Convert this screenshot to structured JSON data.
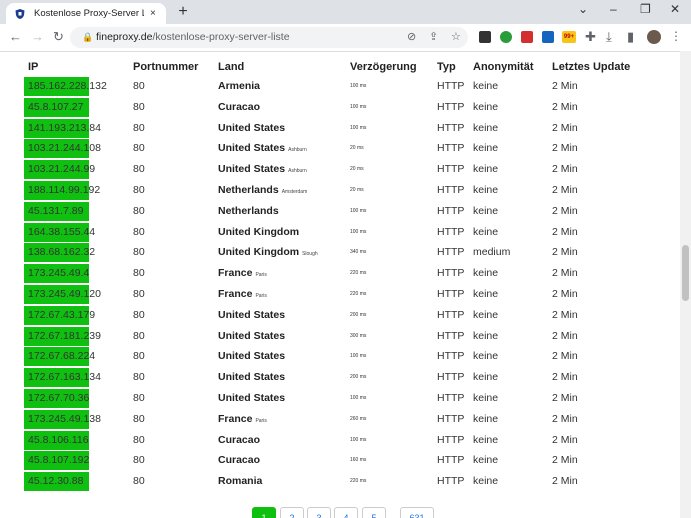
{
  "browser": {
    "tab_title": "Kostenlose Proxy-Server Liste: M",
    "url_domain": "fineproxy.de",
    "url_path": "/kostenlose-proxy-server-liste",
    "new_tab": "+",
    "close_tab": "×",
    "min": "⌄",
    "restore": "–",
    "maximize": "❐",
    "close": "✕",
    "badge_99": "99+"
  },
  "table": {
    "headers": {
      "ip": "IP",
      "port": "Portnummer",
      "country": "Land",
      "delay": "Verzögerung",
      "type": "Typ",
      "anon": "Anonymität",
      "update": "Letztes Update"
    },
    "rows": [
      {
        "ip": "185.162.228.132",
        "port": "80",
        "country": "Armenia",
        "city": "",
        "delay": "100 ms",
        "type": "HTTP",
        "anon": "keine",
        "update": "2 Min"
      },
      {
        "ip": "45.8.107.27",
        "port": "80",
        "country": "Curacao",
        "city": "",
        "delay": "100 ms",
        "type": "HTTP",
        "anon": "keine",
        "update": "2 Min"
      },
      {
        "ip": "141.193.213.84",
        "port": "80",
        "country": "United States",
        "city": "",
        "delay": "100 ms",
        "type": "HTTP",
        "anon": "keine",
        "update": "2 Min"
      },
      {
        "ip": "103.21.244.108",
        "port": "80",
        "country": "United States",
        "city": "Ashburn",
        "delay": "20 ms",
        "type": "HTTP",
        "anon": "keine",
        "update": "2 Min"
      },
      {
        "ip": "103.21.244.99",
        "port": "80",
        "country": "United States",
        "city": "Ashburn",
        "delay": "20 ms",
        "type": "HTTP",
        "anon": "keine",
        "update": "2 Min"
      },
      {
        "ip": "188.114.99.192",
        "port": "80",
        "country": "Netherlands",
        "city": "Amsterdam",
        "delay": "20 ms",
        "type": "HTTP",
        "anon": "keine",
        "update": "2 Min"
      },
      {
        "ip": "45.131.7.89",
        "port": "80",
        "country": "Netherlands",
        "city": "",
        "delay": "100 ms",
        "type": "HTTP",
        "anon": "keine",
        "update": "2 Min"
      },
      {
        "ip": "164.38.155.44",
        "port": "80",
        "country": "United Kingdom",
        "city": "",
        "delay": "100 ms",
        "type": "HTTP",
        "anon": "keine",
        "update": "2 Min"
      },
      {
        "ip": "138.68.162.32",
        "port": "80",
        "country": "United Kingdom",
        "city": "Slough",
        "delay": "340 ms",
        "type": "HTTP",
        "anon": "medium",
        "update": "2 Min"
      },
      {
        "ip": "173.245.49.4",
        "port": "80",
        "country": "France",
        "city": "Paris",
        "delay": "220 ms",
        "type": "HTTP",
        "anon": "keine",
        "update": "2 Min"
      },
      {
        "ip": "173.245.49.120",
        "port": "80",
        "country": "France",
        "city": "Paris",
        "delay": "220 ms",
        "type": "HTTP",
        "anon": "keine",
        "update": "2 Min"
      },
      {
        "ip": "172.67.43.179",
        "port": "80",
        "country": "United States",
        "city": "",
        "delay": "200 ms",
        "type": "HTTP",
        "anon": "keine",
        "update": "2 Min"
      },
      {
        "ip": "172.67.181.239",
        "port": "80",
        "country": "United States",
        "city": "",
        "delay": "300 ms",
        "type": "HTTP",
        "anon": "keine",
        "update": "2 Min"
      },
      {
        "ip": "172.67.68.224",
        "port": "80",
        "country": "United States",
        "city": "",
        "delay": "100 ms",
        "type": "HTTP",
        "anon": "keine",
        "update": "2 Min"
      },
      {
        "ip": "172.67.163.134",
        "port": "80",
        "country": "United States",
        "city": "",
        "delay": "200 ms",
        "type": "HTTP",
        "anon": "keine",
        "update": "2 Min"
      },
      {
        "ip": "172.67.70.36",
        "port": "80",
        "country": "United States",
        "city": "",
        "delay": "100 ms",
        "type": "HTTP",
        "anon": "keine",
        "update": "2 Min"
      },
      {
        "ip": "173.245.49.138",
        "port": "80",
        "country": "France",
        "city": "Paris",
        "delay": "260 ms",
        "type": "HTTP",
        "anon": "keine",
        "update": "2 Min"
      },
      {
        "ip": "45.8.106.116",
        "port": "80",
        "country": "Curacao",
        "city": "",
        "delay": "100 ms",
        "type": "HTTP",
        "anon": "keine",
        "update": "2 Min"
      },
      {
        "ip": "45.8.107.192",
        "port": "80",
        "country": "Curacao",
        "city": "",
        "delay": "160 ms",
        "type": "HTTP",
        "anon": "keine",
        "update": "2 Min"
      },
      {
        "ip": "45.12.30.88",
        "port": "80",
        "country": "Romania",
        "city": "",
        "delay": "220 ms",
        "type": "HTTP",
        "anon": "keine",
        "update": "2 Min"
      }
    ]
  },
  "pagination": [
    "1",
    "2",
    "3",
    "4",
    "5",
    "631"
  ],
  "colors": {
    "ip_highlight": "#10c010"
  }
}
